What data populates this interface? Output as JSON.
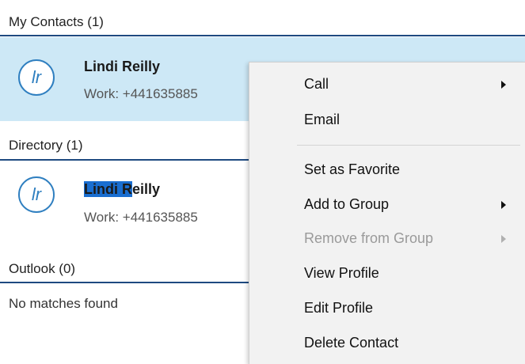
{
  "sections": {
    "my_contacts": {
      "title": "My Contacts (1)"
    },
    "directory": {
      "title": "Directory (1)"
    },
    "outlook": {
      "title": "Outlook (0)",
      "empty": "No matches found"
    }
  },
  "contacts": {
    "favorite": {
      "initials": "lr",
      "name": "Lindi Reilly",
      "phone": "Work: +441635885"
    },
    "directory": {
      "initials": "lr",
      "name_highlight": "Lindi R",
      "name_rest": "eilly",
      "phone": "Work: +441635885"
    }
  },
  "context_menu": {
    "call": "Call",
    "email": "Email",
    "set_favorite": "Set as Favorite",
    "add_group": "Add to Group",
    "remove_group": "Remove from Group",
    "view_profile": "View Profile",
    "edit_profile": "Edit Profile",
    "delete_contact": "Delete Contact"
  },
  "colors": {
    "accent": "#2f7fc0",
    "selected_row": "#cde8f6",
    "highlight": "#1a6ed0",
    "divider": "#1e4a80"
  }
}
